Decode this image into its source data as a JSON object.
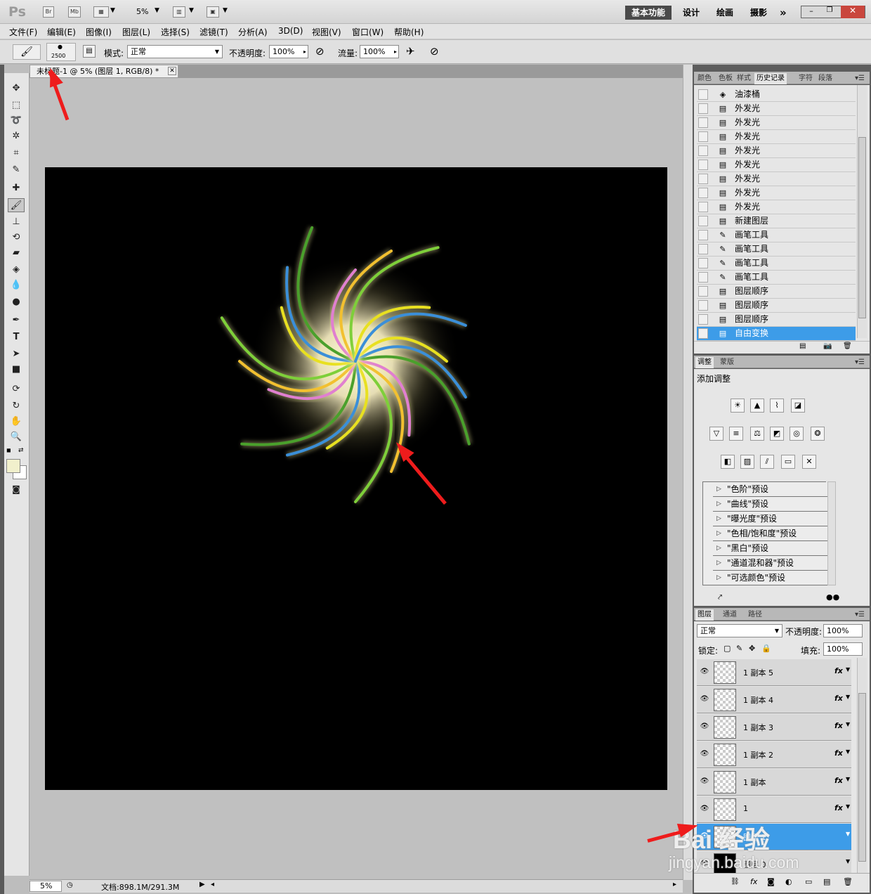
{
  "app": {
    "logo": "Ps"
  },
  "titlebar": {
    "zoom": "5%",
    "workspaces": [
      "基本功能",
      "设计",
      "绘画",
      "摄影"
    ],
    "more": "»"
  },
  "menu": [
    "文件(F)",
    "编辑(E)",
    "图像(I)",
    "图层(L)",
    "选择(S)",
    "滤镜(T)",
    "分析(A)",
    "3D(D)",
    "视图(V)",
    "窗口(W)",
    "帮助(H)"
  ],
  "options": {
    "brush_size": "2500",
    "mode_label": "模式:",
    "mode_value": "正常",
    "opacity_label": "不透明度:",
    "opacity_value": "100%",
    "flow_label": "流量:",
    "flow_value": "100%"
  },
  "document": {
    "tab_title": "未标题-1 @ 5% (图层 1, RGB/8) *",
    "status_zoom": "5%",
    "status_doc": "文档:898.1M/291.3M"
  },
  "history_panel": {
    "tabs": [
      "颜色",
      "色板",
      "样式",
      "历史记录",
      "字符",
      "段落"
    ],
    "active_tab": "历史记录",
    "items": [
      "油漆桶",
      "外发光",
      "外发光",
      "外发光",
      "外发光",
      "外发光",
      "外发光",
      "外发光",
      "外发光",
      "新建图层",
      "画笔工具",
      "画笔工具",
      "画笔工具",
      "画笔工具",
      "图层顺序",
      "图层顺序",
      "图层顺序",
      "自由变换"
    ],
    "selected_index": 17
  },
  "adjust_panel": {
    "tabs": [
      "调整",
      "蒙版"
    ],
    "title": "添加调整",
    "presets": [
      "\"色阶\"预设",
      "\"曲线\"预设",
      "\"曝光度\"预设",
      "\"色相/饱和度\"预设",
      "\"黑白\"预设",
      "\"通道混和器\"预设",
      "\"可选颜色\"预设"
    ]
  },
  "layers_panel": {
    "tabs": [
      "图层",
      "通道",
      "路径"
    ],
    "blend_mode": "正常",
    "opacity_label": "不透明度:",
    "opacity_value": "100%",
    "lock_label": "锁定:",
    "fill_label": "填充:",
    "fill_value": "100%",
    "layers": [
      {
        "name": "1 副本 5",
        "fx": "fx"
      },
      {
        "name": "1 副本 4",
        "fx": "fx"
      },
      {
        "name": "1 副本 3",
        "fx": "fx"
      },
      {
        "name": "1 副本 2",
        "fx": "fx"
      },
      {
        "name": "1 副本",
        "fx": "fx"
      },
      {
        "name": "1",
        "fx": "fx"
      },
      {
        "name": "图层 1",
        "fx": ""
      },
      {
        "name": "图层 0",
        "fx": ""
      }
    ],
    "selected_index": 6
  },
  "watermark": {
    "text": "Bai 经验",
    "sub": "jingyan.baidu.com"
  },
  "colors": {
    "accent": "#3d9ce8",
    "arrow": "#ee1c1c",
    "canvas": "#000000"
  }
}
